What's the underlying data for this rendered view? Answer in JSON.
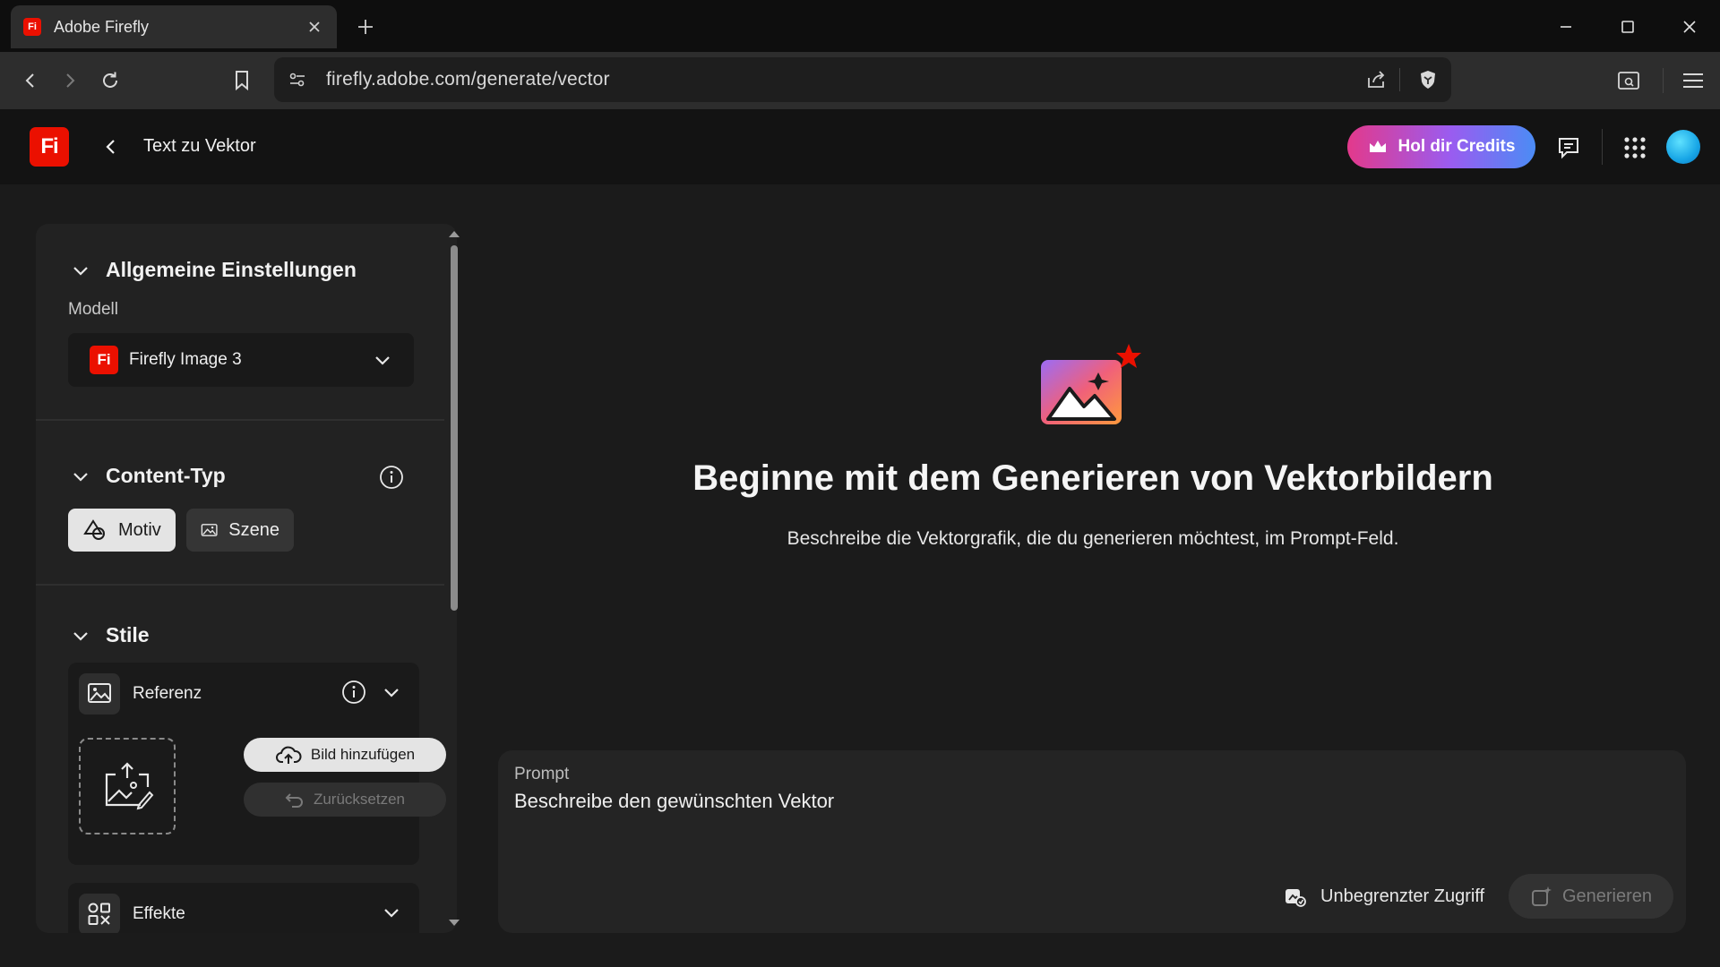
{
  "browser": {
    "tab_title": "Adobe Firefly",
    "tab_favicon": "Fi",
    "url": "firefly.adobe.com/generate/vector"
  },
  "header": {
    "logo": "Fi",
    "title": "Text zu Vektor",
    "credits_label": "Hol dir Credits"
  },
  "sidebar": {
    "general": {
      "title": "Allgemeine Einstellungen",
      "model_label": "Modell",
      "model_logo": "Fi",
      "model_value": "Firefly Image 3"
    },
    "content_type": {
      "title": "Content-Typ",
      "options": [
        "Motiv",
        "Szene"
      ],
      "selected": "Motiv"
    },
    "styles": {
      "title": "Stile",
      "reference_label": "Referenz",
      "add_image_label": "Bild hinzufügen",
      "reset_label": "Zurücksetzen",
      "effects_label": "Effekte"
    }
  },
  "main": {
    "hero_title": "Beginne mit dem Generieren von Vektorbildern",
    "hero_subtitle": "Beschreibe die Vektorgrafik, die du generieren möchtest, im Prompt-Feld.",
    "prompt_label": "Prompt",
    "prompt_placeholder": "Beschreibe den gewünschten Vektor",
    "unlimited_label": "Unbegrenzter Zugriff",
    "generate_label": "Generieren"
  },
  "colors": {
    "accent_red": "#eb1000",
    "credits_gradient_start": "#e3398b",
    "credits_gradient_end": "#4b8cf5",
    "background": "#1b1b1b"
  }
}
